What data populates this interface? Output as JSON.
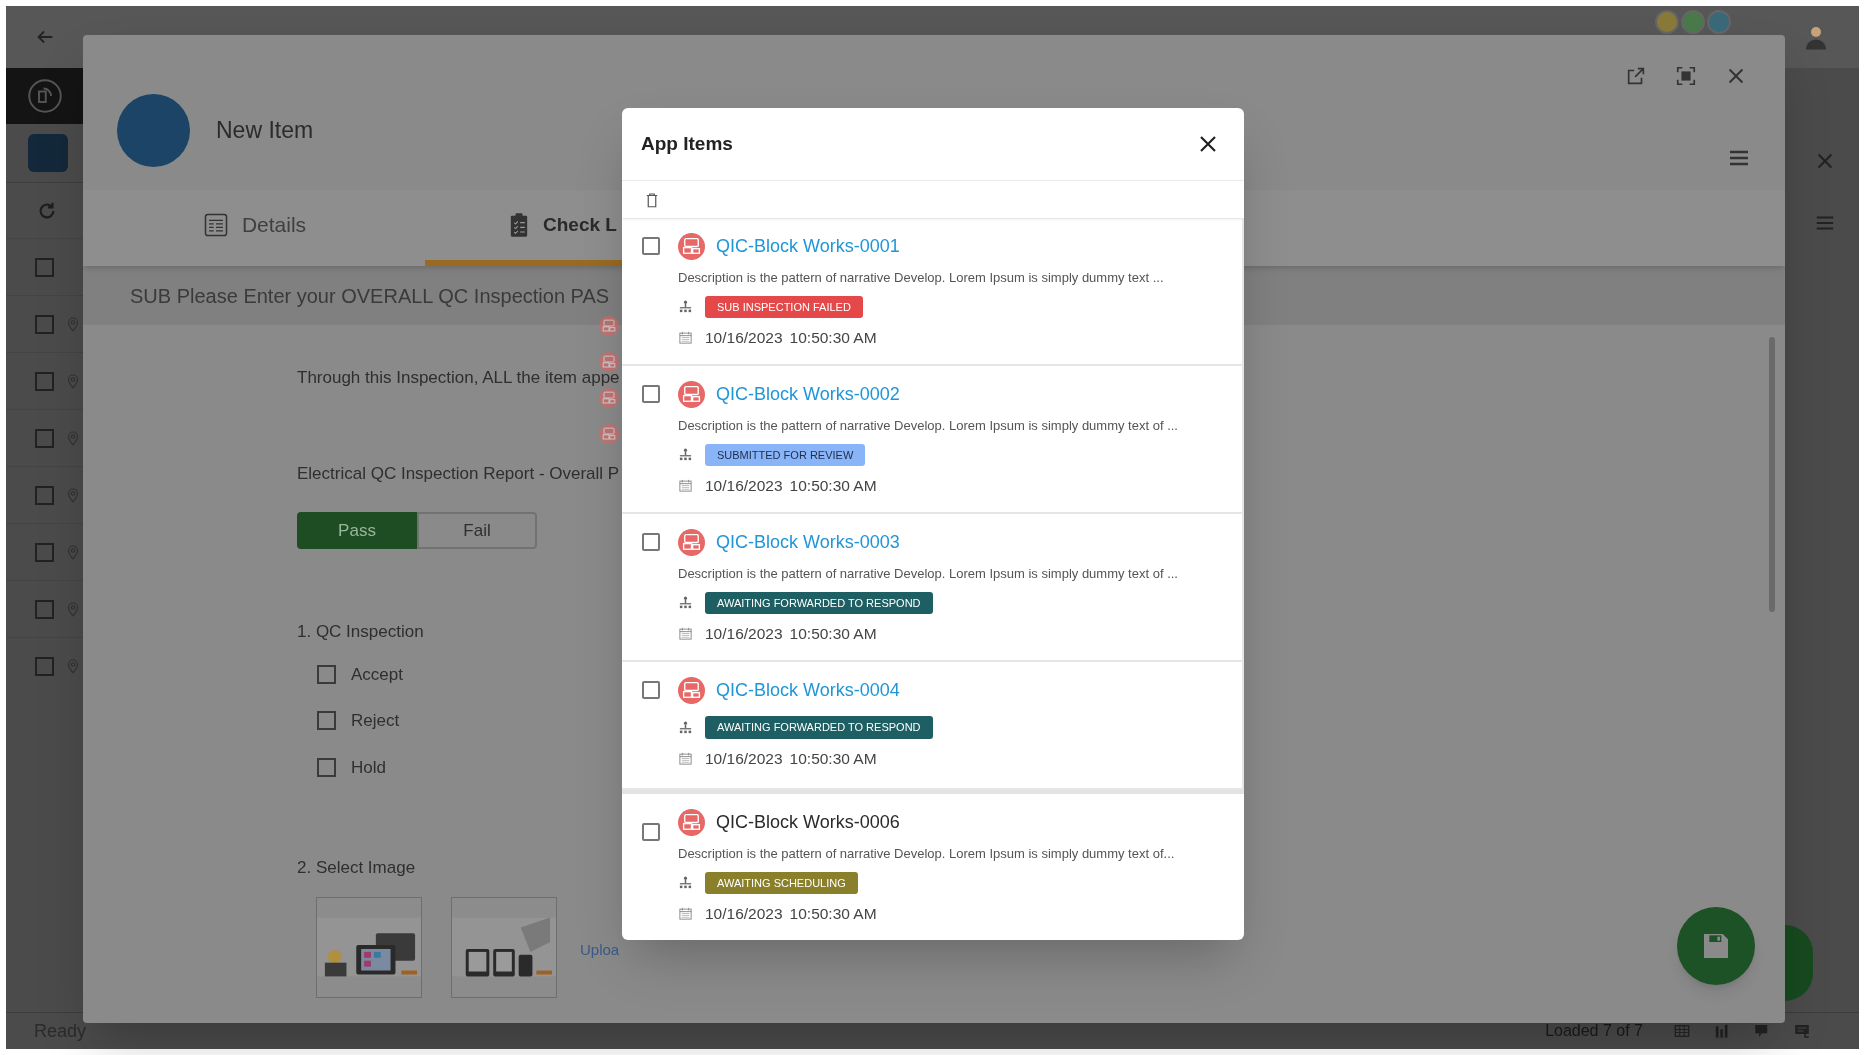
{
  "app": {
    "status": "Ready",
    "loaded": "Loaded 7 of 7",
    "rail_rows": [
      {
        "kind": "plain",
        "checked": false
      },
      {
        "kind": "pinned",
        "checked": false
      },
      {
        "kind": "pinned",
        "checked": false
      },
      {
        "kind": "pinned",
        "checked": false
      },
      {
        "kind": "pinned",
        "checked": false
      },
      {
        "kind": "pinned",
        "checked": false
      },
      {
        "kind": "pinned",
        "checked": false
      },
      {
        "kind": "pinned",
        "checked": false
      }
    ]
  },
  "window": {
    "title": "New Item",
    "tabs": [
      {
        "label": "Details",
        "kind": "details",
        "selected": false
      },
      {
        "label": "Check L",
        "kind": "checklist",
        "selected": true
      }
    ],
    "section_header": "SUB Please Enter your OVERALL QC Inspection PAS",
    "intro": "Through this Inspection, ALL the item appe",
    "report_label": "Electrical QC Inspection Report - Overall P",
    "verdict": [
      {
        "label": "Pass",
        "selected": true
      },
      {
        "label": "Fail",
        "selected": false
      }
    ],
    "question_1": {
      "title": "1. QC Inspection",
      "options": [
        {
          "label": "Accept",
          "checked": false
        },
        {
          "label": "Reject",
          "checked": false
        },
        {
          "label": "Hold",
          "checked": false
        }
      ]
    },
    "question_2": {
      "title": "2. Select Image",
      "upload_link": "Uploa"
    }
  },
  "dialog": {
    "title": "App Items",
    "items": [
      {
        "title": "QIC-Block Works-0001",
        "linked": true,
        "checked": false,
        "description": "Description is the pattern of narrative Develop. Lorem Ipsum is simply dummy text ...",
        "status": "SUB INSPECTION FAILED",
        "color": "#e44848",
        "date": "10/16/2023",
        "time": "10:50:30 AM"
      },
      {
        "title": "QIC-Block Works-0002",
        "linked": true,
        "checked": false,
        "description": "Description is the pattern of narrative Develop. Lorem Ipsum is simply dummy text of ...",
        "status": "SUBMITTED FOR REVIEW",
        "color": "#8ab4f8",
        "date": "10/16/2023",
        "time": "10:50:30 AM"
      },
      {
        "title": "QIC-Block Works-0003",
        "linked": true,
        "checked": false,
        "description": "Description is the pattern of narrative Develop. Lorem Ipsum is simply dummy text of ...",
        "status": "AWAITING FORWARDED TO RESPOND",
        "color": "#1d5f63",
        "date": "10/16/2023",
        "time": "10:50:30 AM"
      },
      {
        "title": "QIC-Block Works-0004",
        "linked": true,
        "checked": false,
        "status": "AWAITING FORWARDED TO RESPOND",
        "color": "#1d5f63",
        "date": "10/16/2023",
        "time": "10:50:30 AM"
      },
      {
        "title": "QIC-Block Works-0006",
        "linked": false,
        "checked": false,
        "description": "Description is the pattern of narrative Develop. Lorem Ipsum is simply dummy text of...",
        "status": "AWAITING SCHEDULING",
        "color": "#8a7f2a",
        "date": "10/16/2023",
        "time": "10:50:30 AM"
      }
    ]
  }
}
